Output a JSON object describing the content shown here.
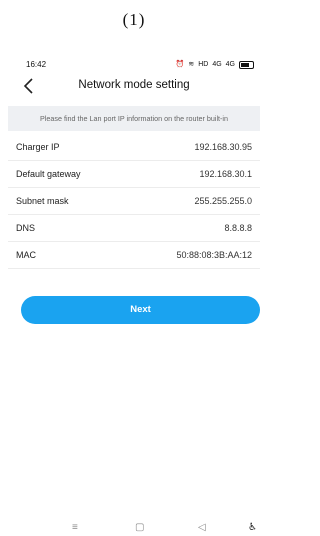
{
  "caption": "(1)",
  "status": {
    "time": "16:42",
    "network": "HD",
    "signal1": "4G",
    "signal2": "4G"
  },
  "header": {
    "title": "Network mode setting"
  },
  "hint": "Please find the Lan port IP information on the router built-in",
  "rows": [
    {
      "label": "Charger IP",
      "value": "192.168.30.95"
    },
    {
      "label": "Default gateway",
      "value": "192.168.30.1"
    },
    {
      "label": "Subnet mask",
      "value": "255.255.255.0"
    },
    {
      "label": "DNS",
      "value": "8.8.8.8"
    },
    {
      "label": "MAC",
      "value": "50:88:08:3B:AA:12"
    }
  ],
  "next_label": "Next",
  "colors": {
    "accent": "#1aa3f0",
    "hint_bg": "#eef0f3"
  },
  "nav": {
    "menu": "≡",
    "home": "▢",
    "back": "◁",
    "accessibility": "♿"
  }
}
